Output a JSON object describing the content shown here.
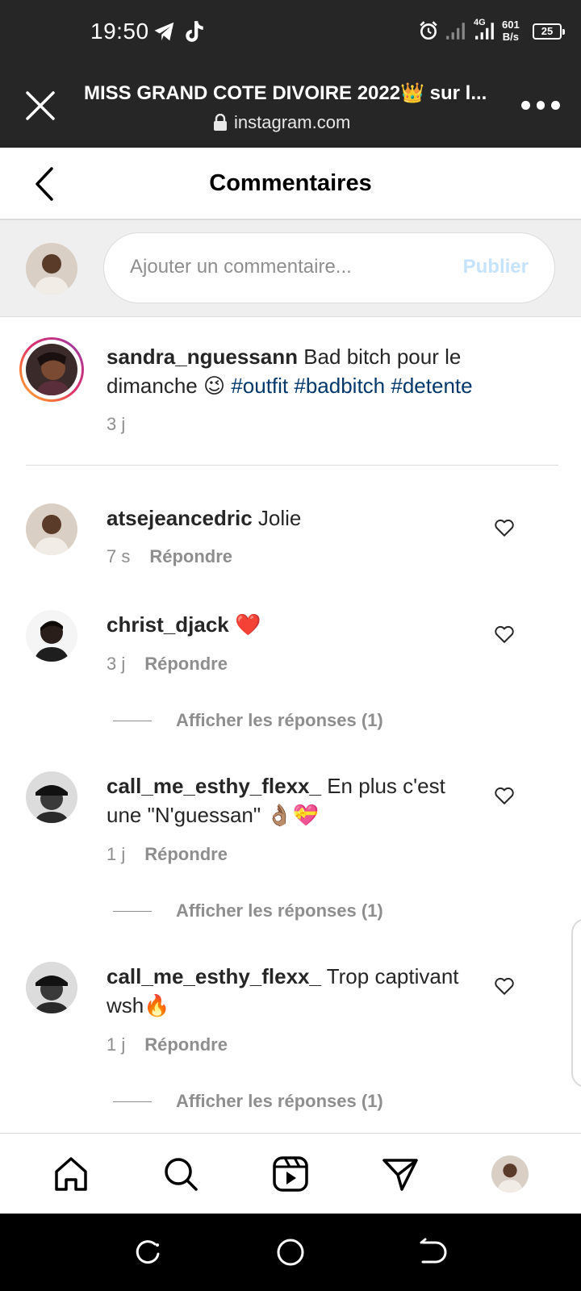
{
  "status_bar": {
    "time": "19:50",
    "network": "4G",
    "speed_value": "601",
    "speed_unit": "B/s",
    "battery": "25"
  },
  "browser": {
    "page_title": "MISS GRAND COTE DIVOIRE 2022👑 sur l...",
    "url": "instagram.com"
  },
  "comments_header": {
    "title": "Commentaires"
  },
  "composer": {
    "placeholder": "Ajouter un commentaire...",
    "publish_label": "Publier"
  },
  "caption": {
    "username": "sandra_nguessann",
    "text_before": "Bad bitch pour le dimanche ",
    "emoji": "😉",
    "hashtags": [
      "#outfit",
      "#badbitch",
      "#detente"
    ],
    "time": "3 j"
  },
  "comments": [
    {
      "username": "atsejeancedric",
      "text": "Jolie",
      "time": "7 s",
      "reply_label": "Répondre",
      "view_replies": ""
    },
    {
      "username": "christ_djack",
      "text": "❤️",
      "time": "3 j",
      "reply_label": "Répondre",
      "view_replies": "Afficher les réponses (1)"
    },
    {
      "username": "call_me_esthy_flexx_",
      "text": "En plus c'est une \"N'guessan\" 👌🏽💝",
      "time": "1 j",
      "reply_label": "Répondre",
      "view_replies": "Afficher les réponses (1)"
    },
    {
      "username": "call_me_esthy_flexx_",
      "text": "Trop captivant wsh🔥",
      "time": "1 j",
      "reply_label": "Répondre",
      "view_replies": "Afficher les réponses (1)"
    }
  ],
  "colors": {
    "hashtag": "#00376b",
    "publish_disabled": "#c6e3fd",
    "secondary_text": "#8e8e8e",
    "header_bg": "#262626"
  },
  "icons": {
    "bottom_nav": [
      "home-icon",
      "search-icon",
      "reels-icon",
      "direct-icon",
      "profile-avatar"
    ],
    "system_nav": [
      "recents-icon",
      "home-circle-icon",
      "back-icon"
    ]
  }
}
